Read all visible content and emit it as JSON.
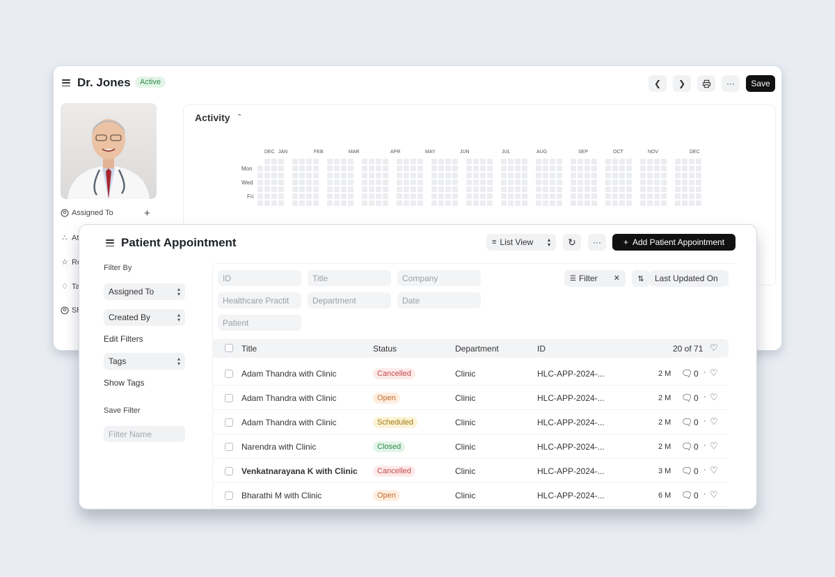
{
  "doctor": {
    "name": "Dr. Jones",
    "status": "Active",
    "save_label": "Save",
    "sidebar": [
      {
        "label": "Assigned To",
        "icon": "assign-icon"
      },
      {
        "label": "At",
        "icon": "paperclip-icon"
      },
      {
        "label": "Re",
        "icon": "star-icon"
      },
      {
        "label": "Ta",
        "icon": "tag-icon"
      },
      {
        "label": "Sh",
        "icon": "share-icon"
      }
    ],
    "activity": {
      "title": "Activity",
      "months": [
        "DEC",
        "JAN",
        "FEB",
        "MAR",
        "APR",
        "MAY",
        "JUN",
        "JUL",
        "AUG",
        "SEP",
        "OCT",
        "NOV",
        "DEC"
      ],
      "days": [
        "Mon",
        "Wed",
        "Fri"
      ]
    }
  },
  "appointments": {
    "title": "Patient Appointment",
    "view_label": "List View",
    "add_label": "Add Patient Appointment",
    "sidebar": {
      "filter_by": "Filter By",
      "assigned_to": "Assigned To",
      "created_by": "Created By",
      "edit_filters": "Edit Filters",
      "tags": "Tags",
      "show_tags": "Show Tags",
      "save_filter": "Save Filter",
      "filter_name_placeholder": "Filter Name"
    },
    "filters": {
      "id": "ID",
      "title": "Title",
      "company": "Company",
      "practitioner": "Healthcare Practit",
      "department": "Department",
      "date": "Date",
      "patient": "Patient",
      "filter_label": "Filter",
      "sort_label": "Last Updated On"
    },
    "columns": {
      "title": "Title",
      "status": "Status",
      "department": "Department",
      "id": "ID",
      "count": "20 of 71"
    },
    "rows": [
      {
        "title": "Adam Thandra with Clinic",
        "status": "Cancelled",
        "department": "Clinic",
        "id": "HLC-APP-2024-...",
        "age": "2 M",
        "comments": "0"
      },
      {
        "title": "Adam Thandra with Clinic",
        "status": "Open",
        "department": "Clinic",
        "id": "HLC-APP-2024-...",
        "age": "2 M",
        "comments": "0"
      },
      {
        "title": "Adam Thandra with Clinic",
        "status": "Scheduled",
        "department": "Clinic",
        "id": "HLC-APP-2024-...",
        "age": "2 M",
        "comments": "0"
      },
      {
        "title": "Narendra with Clinic",
        "status": "Closed",
        "department": "Clinic",
        "id": "HLC-APP-2024-...",
        "age": "2 M",
        "comments": "0"
      },
      {
        "title": "Venkatnarayana K with Clinic",
        "status": "Cancelled",
        "department": "Clinic",
        "id": "HLC-APP-2024-...",
        "age": "3 M",
        "comments": "0"
      },
      {
        "title": "Bharathi M with Clinic",
        "status": "Open",
        "department": "Clinic",
        "id": "HLC-APP-2024-...",
        "age": "6 M",
        "comments": "0"
      }
    ]
  }
}
